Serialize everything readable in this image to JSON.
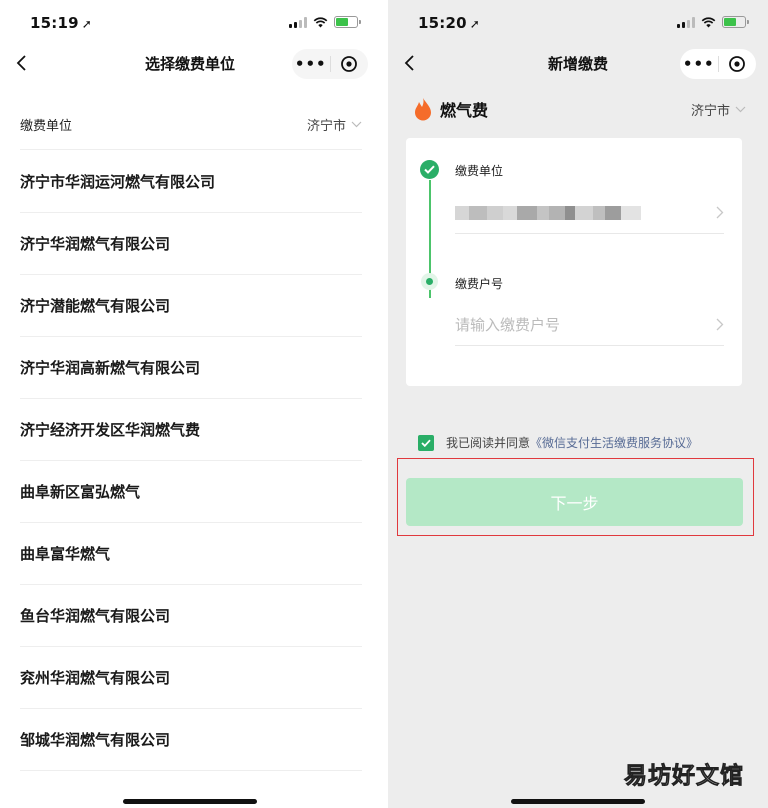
{
  "left": {
    "status": {
      "time": "15:19"
    },
    "nav": {
      "title": "选择缴费单位",
      "more": "•••"
    },
    "header": {
      "label": "缴费单位",
      "city": "济宁市"
    },
    "companies": [
      "济宁市华润运河燃气有限公司",
      "济宁华润燃气有限公司",
      "济宁潜能燃气有限公司",
      "济宁华润高新燃气有限公司",
      "济宁经济开发区华润燃气费",
      "曲阜新区富弘燃气",
      "曲阜富华燃气",
      "鱼台华润燃气有限公司",
      "兖州华润燃气有限公司",
      "邹城华润燃气有限公司"
    ]
  },
  "right": {
    "status": {
      "time": "15:20"
    },
    "nav": {
      "title": "新增缴费",
      "more": "•••"
    },
    "category": {
      "name": "燃气费",
      "city": "济宁市",
      "icon": "flame-icon"
    },
    "steps": {
      "unit_label": "缴费单位",
      "account_label": "缴费户号",
      "account_placeholder": "请输入缴费户号"
    },
    "agreement": {
      "text": "我已阅读并同意",
      "link": "《微信支付生活缴费服务协议》"
    },
    "next_button": "下一步",
    "watermark": "易坊好文馆"
  },
  "colors": {
    "accent_green": "#2aae67",
    "button_disabled": "#b4e8c6",
    "link": "#576b95",
    "highlight_border": "#e0393e",
    "flame": "#f56c2a"
  }
}
